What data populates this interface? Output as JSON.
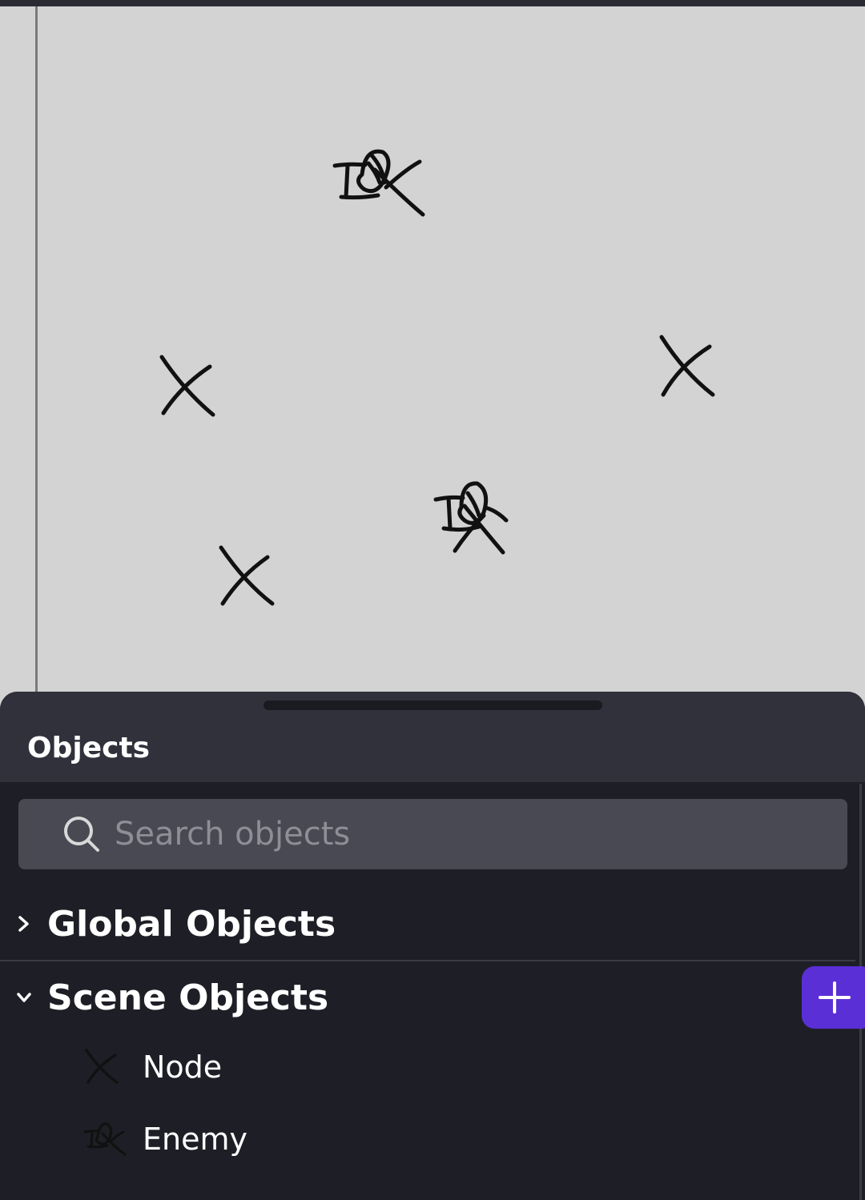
{
  "scene": {
    "instances": [
      {
        "object": "Enemy-icon"
      },
      {
        "object": "Node-icon"
      },
      {
        "object": "Node-icon"
      },
      {
        "object": "Enemy-icon"
      },
      {
        "object": "Node-icon"
      }
    ]
  },
  "panel": {
    "title": "Objects",
    "search": {
      "placeholder": "Search objects",
      "value": ""
    },
    "groups": {
      "global": {
        "label": "Global Objects",
        "expanded": false
      },
      "scene": {
        "label": "Scene Objects",
        "expanded": true,
        "items": [
          {
            "name": "Node",
            "icon": "node-sprite-icon"
          },
          {
            "name": "Enemy",
            "icon": "enemy-sprite-icon"
          }
        ]
      }
    }
  },
  "colors": {
    "canvas": "#d3d3d3",
    "panel_bg": "#1e1f26",
    "panel_header": "#30313b",
    "search_bg": "#484953",
    "accent": "#5b2fd6",
    "text": "#ffffff",
    "placeholder": "#8d8e96"
  }
}
